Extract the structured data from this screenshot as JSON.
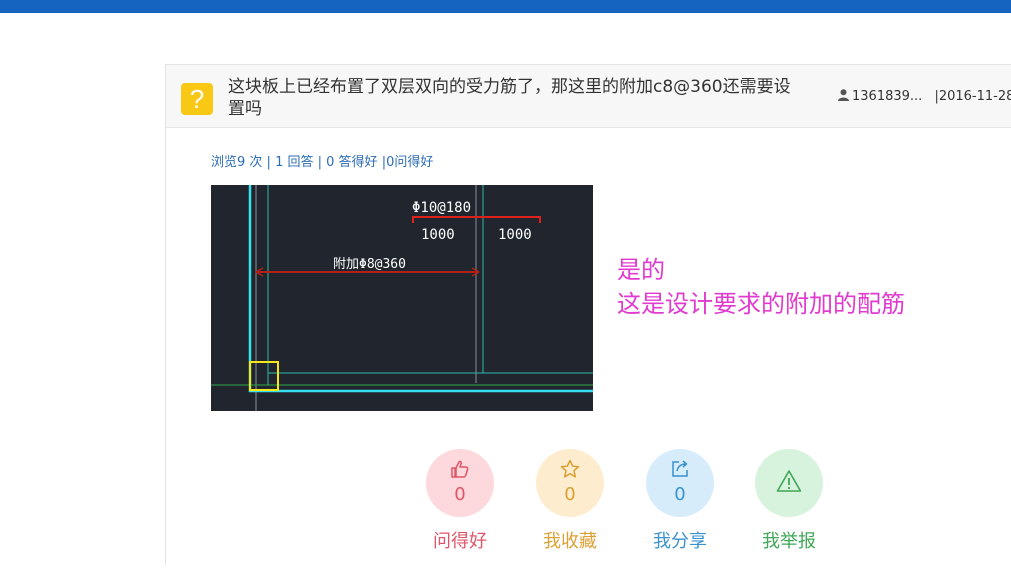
{
  "question": {
    "title": "这块板上已经布置了双层双向的受力筋了，那这里的附加c8@360还需要设置吗",
    "user": "1361839...",
    "date_separator": "|",
    "date": "2016-11-28"
  },
  "stats": {
    "views": "浏览9 次",
    "answers": "1 回答",
    "good_answers": "0 答得好",
    "good_questions": "0问得好",
    "separator": "|"
  },
  "cad_image": {
    "top_label": "Φ10@180",
    "dim_left": "1000",
    "dim_right": "1000",
    "extra_label": "附加Φ8@360"
  },
  "answer": {
    "line1": "是的",
    "line2": "这是设计要求的附加的配筋"
  },
  "actions": [
    {
      "count": "0",
      "label": "问得好",
      "icon": "thumbs-up-icon",
      "color": "#e05568"
    },
    {
      "count": "0",
      "label": "我收藏",
      "icon": "star-icon",
      "color": "#dba136"
    },
    {
      "count": "0",
      "label": "我分享",
      "icon": "share-icon",
      "color": "#3a92cf"
    },
    {
      "count": "0",
      "label": "我举报",
      "icon": "warning-icon",
      "color": "#3fa757"
    }
  ]
}
